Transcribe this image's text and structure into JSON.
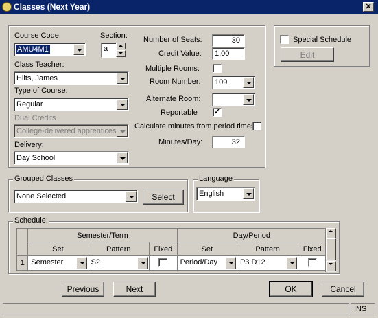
{
  "window": {
    "title": "Classes  (Next Year)",
    "close_glyph": "✕"
  },
  "course": {
    "course_code_label": "Course Code:",
    "course_code_value": "AMU4M1",
    "section_label": "Section:",
    "section_value": "a",
    "class_teacher_label": "Class Teacher:",
    "class_teacher_value": "Hilts, James",
    "type_label": "Type of Course:",
    "type_value": "Regular",
    "dual_credits_label": "Dual Credits",
    "dual_credits_value": "College-delivered apprenticesh",
    "delivery_label": "Delivery:",
    "delivery_value": "Day School"
  },
  "seats": {
    "number_of_seats_label": "Number of Seats:",
    "number_of_seats_value": "30",
    "credit_value_label": "Credit Value:",
    "credit_value": "1.00",
    "multiple_rooms_label": "Multiple Rooms:",
    "multiple_rooms_checked": "",
    "room_number_label": "Room Number:",
    "room_number_value": "109",
    "alternate_room_label": "Alternate Room:",
    "alternate_room_value": "",
    "reportable_label": "Reportable",
    "reportable_checked": "✓",
    "calc_minutes_label": "Calculate minutes from period times",
    "calc_minutes_checked": "",
    "minutes_day_label": "Minutes/Day:",
    "minutes_day_value": "32"
  },
  "special": {
    "label": "Special Schedule",
    "checked": "",
    "edit_button": "Edit"
  },
  "grouped": {
    "legend": "Grouped Classes",
    "value": "None Selected",
    "select_button": "Select"
  },
  "language": {
    "legend": "Language",
    "value": "English"
  },
  "schedule": {
    "legend": "Schedule:",
    "group_headers": [
      "Semester/Term",
      "Day/Period"
    ],
    "col_headers": [
      "Set",
      "Pattern",
      "Fixed",
      "Set",
      "Pattern",
      "Fixed"
    ],
    "rows": [
      {
        "num": "1",
        "set1": "Semester",
        "pattern1": "S2",
        "fixed1": "",
        "set2": "Period/Day",
        "pattern2": "P3 D12",
        "fixed2": ""
      }
    ]
  },
  "buttons": {
    "previous": "Previous",
    "next": "Next",
    "ok": "OK",
    "cancel": "Cancel"
  },
  "status": {
    "left": "",
    "ins": "INS"
  }
}
